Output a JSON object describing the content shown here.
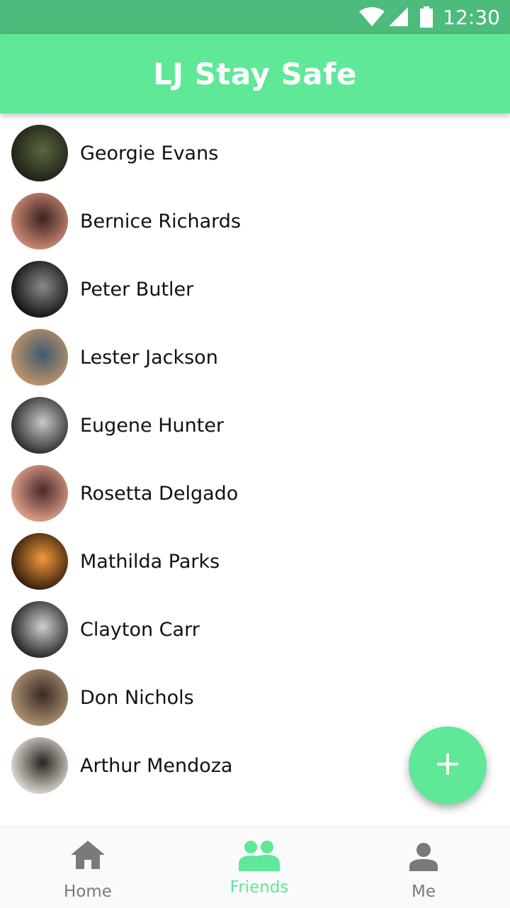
{
  "status_bar": {
    "time": "12:30"
  },
  "app_bar": {
    "title": "LJ Stay Safe"
  },
  "friends": [
    {
      "name": "Georgie Evans",
      "avatar_colors": [
        "#1a1d14",
        "#5a6640"
      ]
    },
    {
      "name": "Bernice Richards",
      "avatar_colors": [
        "#d8917a",
        "#3a2220"
      ]
    },
    {
      "name": "Peter Butler",
      "avatar_colors": [
        "#0a0a0a",
        "#8a8a8a"
      ]
    },
    {
      "name": "Lester Jackson",
      "avatar_colors": [
        "#c89868",
        "#3e5a70"
      ]
    },
    {
      "name": "Eugene Hunter",
      "avatar_colors": [
        "#222222",
        "#c8c8c8"
      ]
    },
    {
      "name": "Rosetta Delgado",
      "avatar_colors": [
        "#e9a890",
        "#4a2a2a"
      ]
    },
    {
      "name": "Mathilda Parks",
      "avatar_colors": [
        "#2a1508",
        "#f09a3a"
      ]
    },
    {
      "name": "Clayton Carr",
      "avatar_colors": [
        "#1a1a1a",
        "#d0d0d0"
      ]
    },
    {
      "name": "Don Nichols",
      "avatar_colors": [
        "#b49878",
        "#3a2a22"
      ]
    },
    {
      "name": "Arthur Mendoza",
      "avatar_colors": [
        "#e8e4dc",
        "#2a2420"
      ]
    }
  ],
  "fab": {
    "icon": "plus-icon"
  },
  "bottom_nav": {
    "items": [
      {
        "label": "Home",
        "icon": "home-icon",
        "active": false
      },
      {
        "label": "Friends",
        "icon": "people-icon",
        "active": true
      },
      {
        "label": "Me",
        "icon": "person-icon",
        "active": false
      }
    ]
  },
  "colors": {
    "status_bar": "#4cbb7c",
    "accent": "#5ee898",
    "inactive_nav": "#7a7a7a"
  }
}
